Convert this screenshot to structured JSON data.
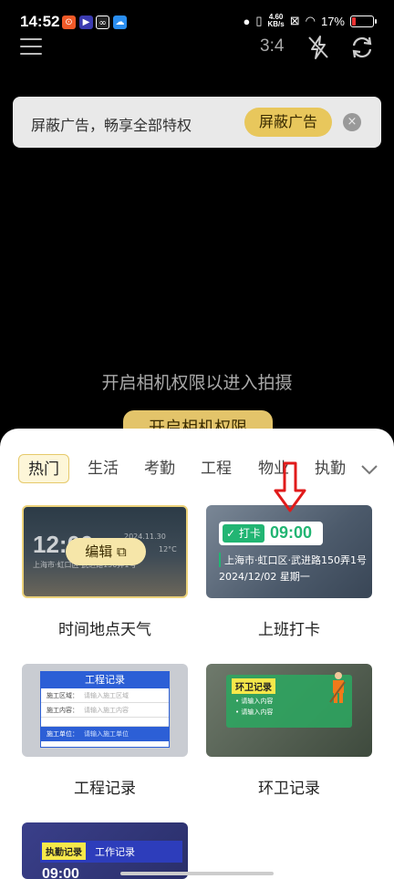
{
  "status_bar": {
    "time": "14:52",
    "network_speed_top": "4.60",
    "network_speed_bottom": "KB/s",
    "battery": "17%",
    "battery_level": 0.17
  },
  "toolbar": {
    "ratio": "3:4"
  },
  "ad_banner": {
    "text": "屏蔽广告，畅享全部特权",
    "button": "屏蔽广告",
    "close": "×"
  },
  "camera": {
    "permission_text": "开启相机权限以进入拍摄",
    "permission_button": "开启相机权限"
  },
  "sheet": {
    "tabs": [
      "热门",
      "生活",
      "考勤",
      "工程",
      "物业",
      "执勤"
    ],
    "cards": [
      {
        "label": "时间地点天气",
        "preview_time": "12:00",
        "preview_date": "2024.11.30",
        "preview_temp": "12°C",
        "preview_location": "上海市·虹口区·武进路150弄1号",
        "edit_label": "编辑"
      },
      {
        "label": "上班打卡",
        "tag": "打卡",
        "time": "09:00",
        "address": "上海市·虹口区·武进路150弄1号",
        "date": "2024/12/02 星期一"
      },
      {
        "label": "工程记录",
        "title": "工程记录",
        "rows": [
          {
            "key": "施工区域：",
            "value": "请输入施工区域"
          },
          {
            "key": "施工内容：",
            "value": "请输入施工内容"
          },
          {
            "key": "施工单位：",
            "value": "请输入施工单位"
          }
        ]
      },
      {
        "label": "环卫记录",
        "tag": "环卫记录",
        "items": [
          "• 请输入内容",
          "• 请输入内容"
        ]
      },
      {
        "tag": "执勤记录",
        "title": "工作记录",
        "time": "09:00"
      }
    ]
  }
}
